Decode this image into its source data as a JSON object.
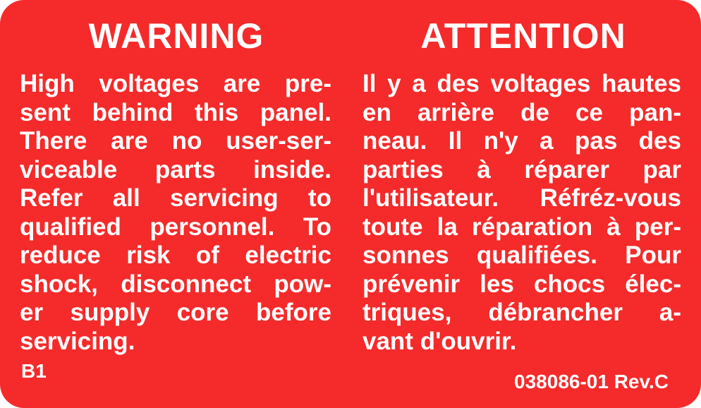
{
  "label": {
    "background": "#f52a2a",
    "text_color": "#ffffff",
    "warning": {
      "heading": "WARNING",
      "lines": [
        "High voltages are pre-",
        "sent behind this panel.",
        "There are no user-ser-",
        "viceable parts inside.",
        "Refer all servicing to",
        "qualified personnel. To",
        "reduce risk of electric",
        "shock, disconnect pow-",
        "er supply core before",
        "servicing."
      ]
    },
    "attention": {
      "heading": "ATTENTION",
      "lines": [
        "Il y a des voltages hautes",
        "en arrière de ce pan-",
        "neau. Il n'y a pas des",
        "parties à réparer par",
        "l'utilisateur. Réfréz-vous",
        "toute la réparation à per-",
        "sonnes qualifiées. Pour",
        "prévenir les chocs élec-",
        "triques, débrancher a-",
        "vant d'ouvrir."
      ]
    },
    "code": "B1",
    "part_number": "038086-01 Rev.C"
  }
}
